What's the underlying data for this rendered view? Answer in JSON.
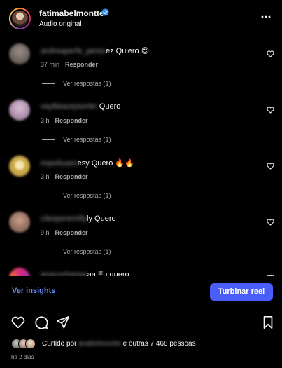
{
  "post": {
    "username": "fatimabelmontte",
    "audio_label": "Áudio original"
  },
  "comments": [
    {
      "blurred_user": "andreaperfe_perez",
      "text": "ez Quiero 😍",
      "time": "37 min",
      "reply_label": "Responder",
      "replies_label": "Ver respostas (1)"
    },
    {
      "blurred_user": "vaylbeautysorter",
      "text": " Quero",
      "time": "3 h",
      "reply_label": "Responder",
      "replies_label": "Ver respostas (1)"
    },
    {
      "blurred_user": "mipelluaes",
      "text": "esy Quero 🔥🔥",
      "time": "3 h",
      "reply_label": "Responder",
      "replies_label": "Ver respostas (1)"
    },
    {
      "blurred_user": "cilesperemilly",
      "text": "ly Quero",
      "time": "9 h",
      "reply_label": "Responder",
      "replies_label": "Ver respostas (1)"
    },
    {
      "blurred_user": "anacunhariaa",
      "text": "aa Eu quero",
      "time": "",
      "reply_label": "",
      "replies_label": ""
    }
  ],
  "footer": {
    "insights_label": "Ver insights",
    "boost_label": "Turbinar reel",
    "liked_prefix": "Curtido por",
    "liked_user": "anabelmontte",
    "liked_suffix": "e outras 7.468 pessoas",
    "time_ago": "há 2 dias"
  },
  "colors": {
    "background": "#000000",
    "link_blue": "#6b8dff",
    "boost_button": "#4a5df9",
    "muted_text": "#a8a8a8",
    "verified_badge": "#3897f0"
  },
  "icons": {
    "verified": "verified-badge-icon",
    "more": "more-options-icon",
    "comment_like": "heart-outline-icon",
    "like": "heart-outline-icon",
    "comment": "speech-bubble-icon",
    "share": "paper-plane-icon",
    "save": "bookmark-icon"
  }
}
